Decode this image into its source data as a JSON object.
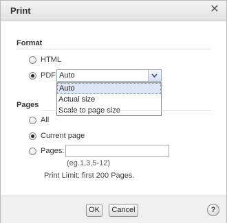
{
  "dialog": {
    "title": "Print"
  },
  "format": {
    "heading": "Format",
    "options": [
      {
        "label": "HTML",
        "selected": false
      },
      {
        "label": "PDF",
        "selected": true
      }
    ],
    "pdf_select": {
      "value": "Auto",
      "options": [
        "Auto",
        "Actual size",
        "Scale to page size"
      ],
      "highlighted": "Auto"
    }
  },
  "pages": {
    "heading": "Pages",
    "options": [
      {
        "label": "All",
        "selected": false
      },
      {
        "label": "Current page",
        "selected": true
      },
      {
        "label": "Pages:",
        "selected": false
      }
    ],
    "range_input_value": "",
    "hint": "(eg.1,3,5-12)",
    "limit_text": "Print Limit: first 200 Pages."
  },
  "footer": {
    "ok_label": "OK",
    "cancel_label": "Cancel",
    "help_label": "?"
  },
  "icons": {
    "close": "close-icon",
    "dropdown": "chevron-down-icon",
    "help": "help-icon"
  }
}
